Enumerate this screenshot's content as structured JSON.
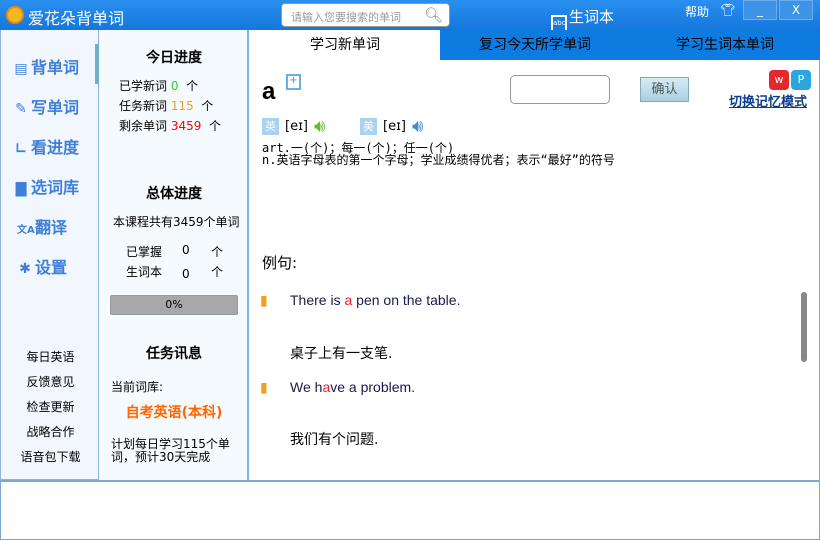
{
  "titlebar": {
    "title": "爱花朵背单词",
    "search_placeholder": "请输入您要搜索的单词",
    "vocab": "生词本",
    "vocab_icon_text": "abc",
    "help": "帮助",
    "minimize": "_",
    "close": "X"
  },
  "nav": [
    {
      "label": "背单词",
      "icon": "list-icon"
    },
    {
      "label": "写单词",
      "icon": "pencil-icon"
    },
    {
      "label": "看进度",
      "icon": "chart-icon"
    },
    {
      "label": "选词库",
      "icon": "book-icon"
    },
    {
      "label": "翻译",
      "icon": "translate-icon"
    },
    {
      "label": "设置",
      "icon": "gear-icon"
    }
  ],
  "links": [
    "每日英语",
    "反馈意见",
    "检查更新",
    "战略合作",
    "语音包下载"
  ],
  "today": {
    "title": "今日进度",
    "learned_label": "已学新词",
    "learned": "0",
    "task_label": "任务新词",
    "task": "115",
    "remain_label": "剩余单词",
    "remain": "3459",
    "unit": "个"
  },
  "overall": {
    "title": "总体进度",
    "total": "本课程共有3459个单词",
    "mastered_label": "已掌握",
    "mastered": "0",
    "vocab_label": "生词本",
    "vocab": "0",
    "unit": "个",
    "progress": "0%"
  },
  "task": {
    "title": "任务讯息",
    "current_label": "当前词库:",
    "library": "自考英语(本科)",
    "plan": "计划每日学习115个单词，预计30天完成"
  },
  "tabs": [
    "学习新单词",
    "复习今天所学单词",
    "学习生词本单词"
  ],
  "word": {
    "text": "a",
    "confirm": "确认",
    "switch_mode": "切换记忆模式",
    "uk_label": "英",
    "uk_phonetic": "[eɪ]",
    "us_label": "美",
    "us_phonetic": "[eɪ]",
    "def1": "art.一(个)；每一(个)；任一(个)",
    "def2": "n.英语字母表的第一个字母；学业成绩得优者；表示“最好”的符号"
  },
  "examples": {
    "title": "例句:",
    "items": [
      {
        "en_pre": "There is ",
        "en_hl": "a",
        "en_post": " pen on the table.",
        "zh": "桌子上有一支笔."
      },
      {
        "en_pre": "We h",
        "en_hl": "a",
        "en_post": "ve a problem.",
        "zh": "我们有个问题."
      }
    ]
  },
  "colors": {
    "titlebar": "#1a7fe0",
    "learned": "#33cc33",
    "task": "#f0a020",
    "remain": "#ff0000",
    "library": "#ff6600"
  }
}
